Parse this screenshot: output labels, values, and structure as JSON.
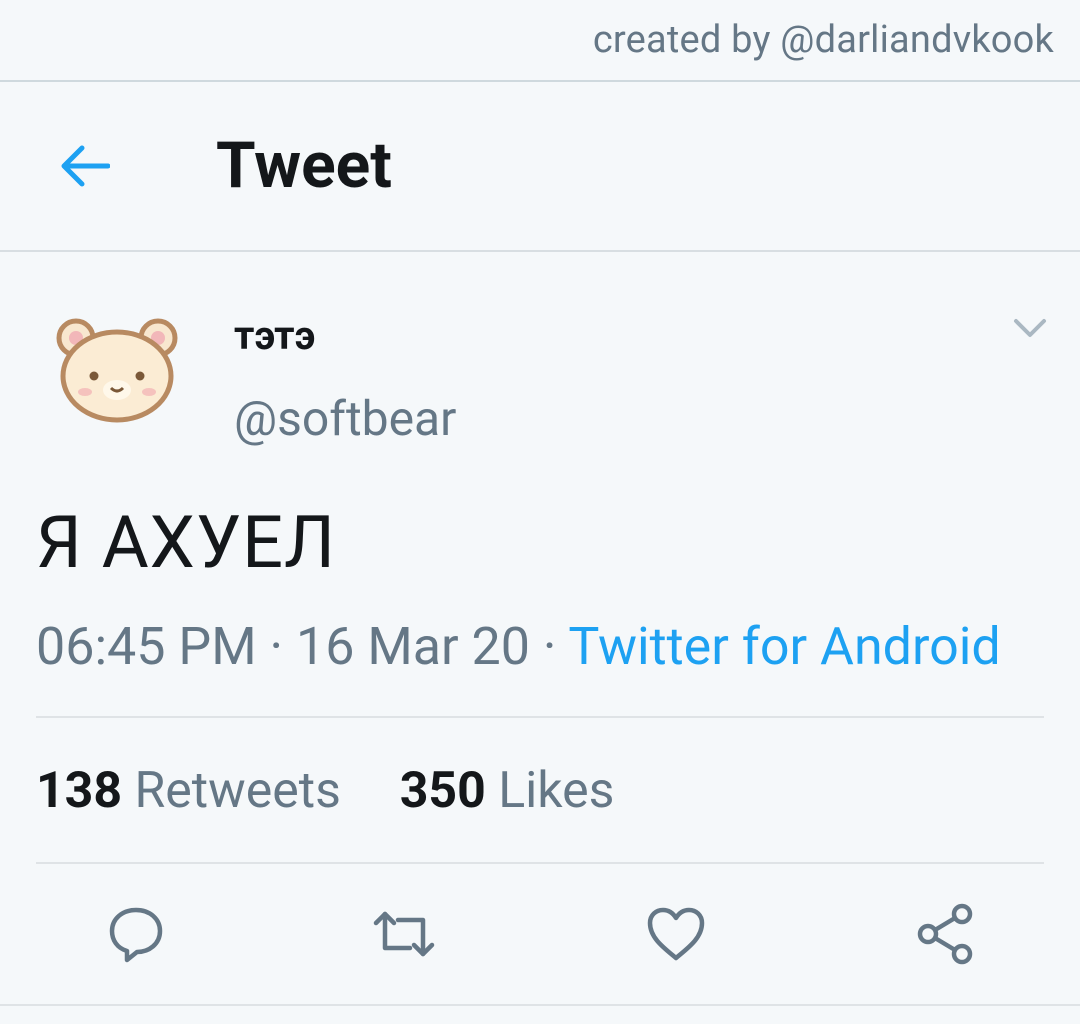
{
  "credit": "created by @darliandvkook",
  "appbar": {
    "title": "Tweet",
    "back_icon": "arrow-left-icon"
  },
  "tweet": {
    "author": {
      "name": "тэтэ",
      "handle": "@softbear",
      "avatar_icon": "bear-face-icon"
    },
    "text": "Я АХУЕЛ",
    "time": "06:45 PM",
    "sep1": " · ",
    "date": "16 Mar 20",
    "sep2": " · ",
    "source": "Twitter for Android",
    "stats": {
      "retweets_count": "138",
      "retweets_label": "Retweets",
      "likes_count": "350",
      "likes_label": "Likes"
    }
  },
  "actions": {
    "reply_icon": "reply-icon",
    "retweet_icon": "retweet-icon",
    "like_icon": "heart-icon",
    "share_icon": "share-icon"
  },
  "colors": {
    "accent": "#1da1f2",
    "secondary_text": "#657786",
    "primary_text": "#14171a",
    "background": "#f5f8fa"
  }
}
